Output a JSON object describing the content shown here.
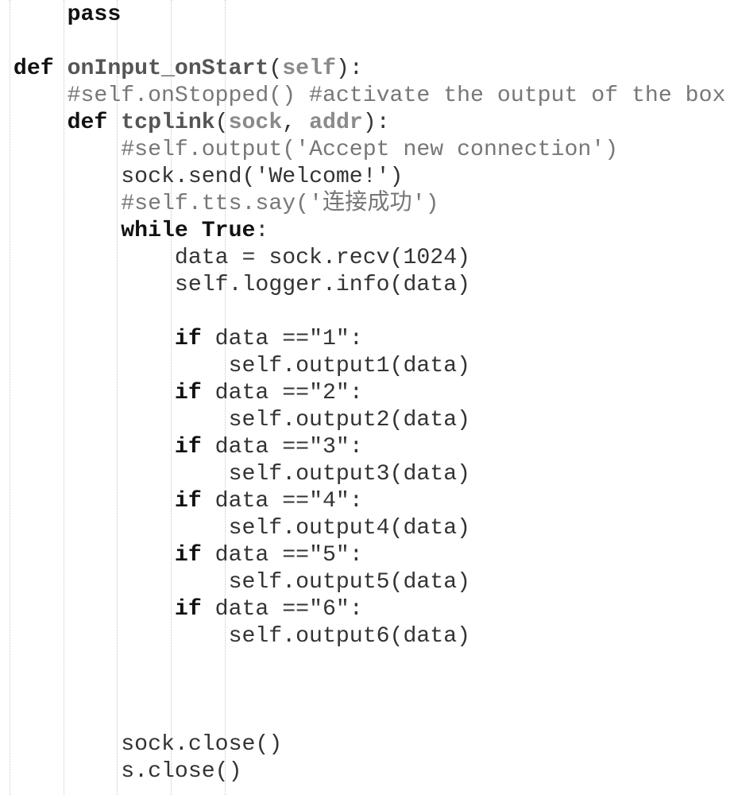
{
  "editor": {
    "lines": [
      {
        "indent": 1,
        "tokens": [
          {
            "t": "pass",
            "c": "kw"
          }
        ]
      },
      {
        "indent": 0,
        "tokens": []
      },
      {
        "indent": 0,
        "tokens": [
          {
            "t": "def",
            "c": "kw"
          },
          {
            "t": " ",
            "c": "pl"
          },
          {
            "t": "onInput_onStart",
            "c": "fn"
          },
          {
            "t": "(",
            "c": "pl"
          },
          {
            "t": "self",
            "c": "param"
          },
          {
            "t": "):",
            "c": "pl"
          }
        ]
      },
      {
        "indent": 1,
        "tokens": [
          {
            "t": "#self.onStopped() #activate the output of the box",
            "c": "cm"
          }
        ]
      },
      {
        "indent": 1,
        "tokens": [
          {
            "t": "def",
            "c": "kw"
          },
          {
            "t": " ",
            "c": "pl"
          },
          {
            "t": "tcplink",
            "c": "fn"
          },
          {
            "t": "(",
            "c": "pl"
          },
          {
            "t": "sock",
            "c": "param"
          },
          {
            "t": ", ",
            "c": "pl"
          },
          {
            "t": "addr",
            "c": "param"
          },
          {
            "t": "):",
            "c": "pl"
          }
        ]
      },
      {
        "indent": 2,
        "tokens": [
          {
            "t": "#self.output('Accept new connection')",
            "c": "cm"
          }
        ]
      },
      {
        "indent": 2,
        "tokens": [
          {
            "t": "sock.send('Welcome!')",
            "c": "pl"
          }
        ]
      },
      {
        "indent": 2,
        "tokens": [
          {
            "t": "#self.tts.say('连接成功')",
            "c": "cm"
          }
        ]
      },
      {
        "indent": 2,
        "tokens": [
          {
            "t": "while",
            "c": "kw"
          },
          {
            "t": " ",
            "c": "pl"
          },
          {
            "t": "True",
            "c": "kw"
          },
          {
            "t": ":",
            "c": "pl"
          }
        ]
      },
      {
        "indent": 3,
        "tokens": [
          {
            "t": "data = sock.recv(1024)",
            "c": "pl"
          }
        ]
      },
      {
        "indent": 3,
        "tokens": [
          {
            "t": "self.logger.info(data)",
            "c": "pl"
          }
        ]
      },
      {
        "indent": 0,
        "tokens": []
      },
      {
        "indent": 3,
        "tokens": [
          {
            "t": "if",
            "c": "kw"
          },
          {
            "t": " data ==\"1\":",
            "c": "pl"
          }
        ]
      },
      {
        "indent": 4,
        "tokens": [
          {
            "t": "self.output1(data)",
            "c": "pl"
          }
        ]
      },
      {
        "indent": 3,
        "tokens": [
          {
            "t": "if",
            "c": "kw"
          },
          {
            "t": " data ==\"2\":",
            "c": "pl"
          }
        ]
      },
      {
        "indent": 4,
        "tokens": [
          {
            "t": "self.output2(data)",
            "c": "pl"
          }
        ]
      },
      {
        "indent": 3,
        "tokens": [
          {
            "t": "if",
            "c": "kw"
          },
          {
            "t": " data ==\"3\":",
            "c": "pl"
          }
        ]
      },
      {
        "indent": 4,
        "tokens": [
          {
            "t": "self.output3(data)",
            "c": "pl"
          }
        ]
      },
      {
        "indent": 3,
        "tokens": [
          {
            "t": "if",
            "c": "kw"
          },
          {
            "t": " data ==\"4\":",
            "c": "pl"
          }
        ]
      },
      {
        "indent": 4,
        "tokens": [
          {
            "t": "self.output4(data)",
            "c": "pl"
          }
        ]
      },
      {
        "indent": 3,
        "tokens": [
          {
            "t": "if",
            "c": "kw"
          },
          {
            "t": " data ==\"5\":",
            "c": "pl"
          }
        ]
      },
      {
        "indent": 4,
        "tokens": [
          {
            "t": "self.output5(data)",
            "c": "pl"
          }
        ]
      },
      {
        "indent": 3,
        "tokens": [
          {
            "t": "if",
            "c": "kw"
          },
          {
            "t": " data ==\"6\":",
            "c": "pl"
          }
        ]
      },
      {
        "indent": 4,
        "tokens": [
          {
            "t": "self.output6(data)",
            "c": "pl"
          }
        ]
      },
      {
        "indent": 0,
        "tokens": []
      },
      {
        "indent": 0,
        "tokens": []
      },
      {
        "indent": 0,
        "tokens": []
      },
      {
        "indent": 2,
        "tokens": [
          {
            "t": "sock.close()",
            "c": "pl"
          }
        ]
      },
      {
        "indent": 2,
        "tokens": [
          {
            "t": "s.close()",
            "c": "pl"
          }
        ]
      }
    ]
  }
}
